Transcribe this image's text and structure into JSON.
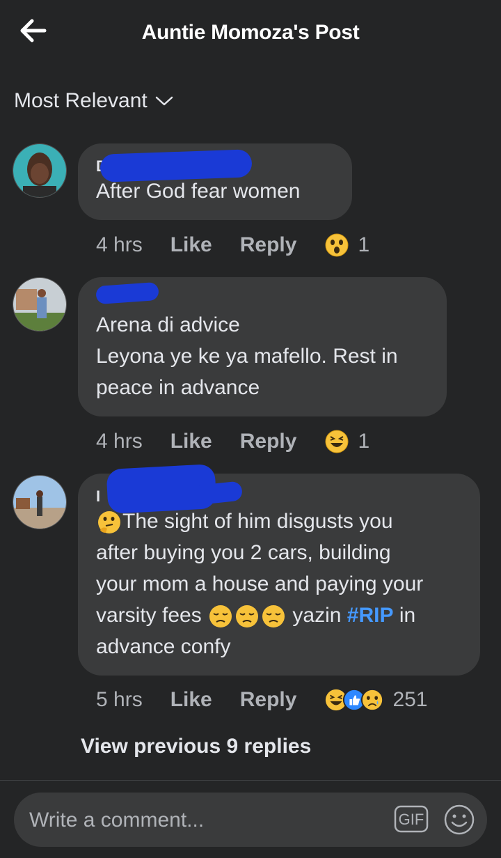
{
  "header": {
    "title": "Auntie Momoza's Post"
  },
  "sort": {
    "label": "Most Relevant"
  },
  "comments": [
    {
      "author": "Di",
      "lines": [
        "After God fear women"
      ],
      "time": "4 hrs",
      "like_label": "Like",
      "reply_label": "Reply",
      "reaction_icons": [
        "wow-emoji-icon"
      ],
      "reaction_count": "1"
    },
    {
      "author": "",
      "lines": [
        "Arena di advice",
        "Leyona ye ke ya mafello. Rest in",
        "peace in advance"
      ],
      "time": "4 hrs",
      "like_label": "Like",
      "reply_label": "Reply",
      "reaction_icons": [
        "haha-emoji-icon"
      ],
      "reaction_count": "1"
    },
    {
      "author": "I",
      "lines": [
        "The sight of him disgusts you",
        "after buying you 2 cars, building",
        "your mom a house and paying your",
        "varsity fees",
        "yazin",
        "#RIP",
        "in",
        "advance confy"
      ],
      "time": "5 hrs",
      "like_label": "Like",
      "reply_label": "Reply",
      "reaction_icons": [
        "haha-emoji-icon",
        "like-emoji-icon",
        "sad-emoji-icon"
      ],
      "reaction_count": "251"
    }
  ],
  "replies": {
    "view_previous_label": "View previous 9 replies"
  },
  "composer": {
    "placeholder": "Write a comment...",
    "gif_label": "GIF"
  },
  "colors": {
    "background": "#242526",
    "bubble": "#3a3b3c",
    "hashtag": "#4599ff",
    "redaction": "#1a3ad6"
  }
}
